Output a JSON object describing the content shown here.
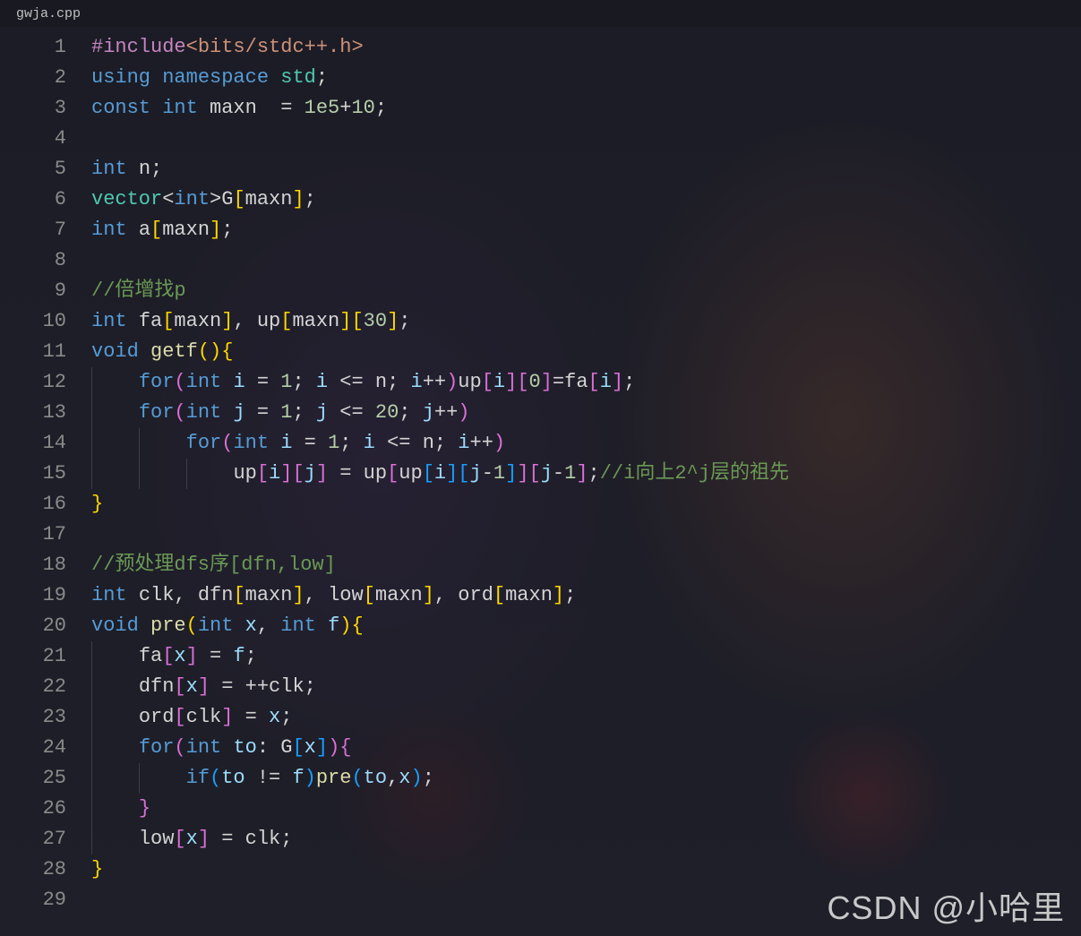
{
  "tab": {
    "filename": "gwja.cpp"
  },
  "watermark": "CSDN @小哈里",
  "gutter": {
    "start": 1,
    "end": 29
  },
  "code": {
    "lines": [
      {
        "n": 1,
        "tokens": [
          {
            "t": "#include",
            "c": "c-preproc"
          },
          {
            "t": "<bits/stdc++.h>",
            "c": "c-include"
          }
        ]
      },
      {
        "n": 2,
        "tokens": [
          {
            "t": "using",
            "c": "c-keyword"
          },
          {
            "t": " "
          },
          {
            "t": "namespace",
            "c": "c-keyword"
          },
          {
            "t": " "
          },
          {
            "t": "std",
            "c": "c-namespace"
          },
          {
            "t": ";",
            "c": "c-punct"
          }
        ]
      },
      {
        "n": 3,
        "tokens": [
          {
            "t": "const",
            "c": "c-const"
          },
          {
            "t": " "
          },
          {
            "t": "int",
            "c": "c-type"
          },
          {
            "t": " "
          },
          {
            "t": "maxn",
            "c": "c-id"
          },
          {
            "t": "  = "
          },
          {
            "t": "1e5",
            "c": "c-num"
          },
          {
            "t": "+",
            "c": "c-op"
          },
          {
            "t": "10",
            "c": "c-num"
          },
          {
            "t": ";",
            "c": "c-punct"
          }
        ]
      },
      {
        "n": 4,
        "tokens": []
      },
      {
        "n": 5,
        "tokens": [
          {
            "t": "int",
            "c": "c-type"
          },
          {
            "t": " "
          },
          {
            "t": "n",
            "c": "c-id"
          },
          {
            "t": ";",
            "c": "c-punct"
          }
        ]
      },
      {
        "n": 6,
        "tokens": [
          {
            "t": "vector",
            "c": "c-namespace"
          },
          {
            "t": "<",
            "c": "c-punct"
          },
          {
            "t": "int",
            "c": "c-type"
          },
          {
            "t": ">",
            "c": "c-punct"
          },
          {
            "t": "G",
            "c": "c-id"
          },
          {
            "t": "[",
            "c": "c-bracket-y"
          },
          {
            "t": "maxn",
            "c": "c-id"
          },
          {
            "t": "]",
            "c": "c-bracket-y"
          },
          {
            "t": ";",
            "c": "c-punct"
          }
        ]
      },
      {
        "n": 7,
        "tokens": [
          {
            "t": "int",
            "c": "c-type"
          },
          {
            "t": " "
          },
          {
            "t": "a",
            "c": "c-id"
          },
          {
            "t": "[",
            "c": "c-bracket-y"
          },
          {
            "t": "maxn",
            "c": "c-id"
          },
          {
            "t": "]",
            "c": "c-bracket-y"
          },
          {
            "t": ";",
            "c": "c-punct"
          }
        ]
      },
      {
        "n": 8,
        "tokens": []
      },
      {
        "n": 9,
        "tokens": [
          {
            "t": "//倍增找p",
            "c": "c-comment"
          }
        ]
      },
      {
        "n": 10,
        "tokens": [
          {
            "t": "int",
            "c": "c-type"
          },
          {
            "t": " "
          },
          {
            "t": "fa",
            "c": "c-id"
          },
          {
            "t": "[",
            "c": "c-bracket-y"
          },
          {
            "t": "maxn",
            "c": "c-id"
          },
          {
            "t": "]",
            "c": "c-bracket-y"
          },
          {
            "t": ", "
          },
          {
            "t": "up",
            "c": "c-id"
          },
          {
            "t": "[",
            "c": "c-bracket-y"
          },
          {
            "t": "maxn",
            "c": "c-id"
          },
          {
            "t": "]",
            "c": "c-bracket-y"
          },
          {
            "t": "[",
            "c": "c-bracket-y"
          },
          {
            "t": "30",
            "c": "c-num"
          },
          {
            "t": "]",
            "c": "c-bracket-y"
          },
          {
            "t": ";",
            "c": "c-punct"
          }
        ]
      },
      {
        "n": 11,
        "tokens": [
          {
            "t": "void",
            "c": "c-type"
          },
          {
            "t": " "
          },
          {
            "t": "getf",
            "c": "c-func"
          },
          {
            "t": "(",
            "c": "c-bracket-y"
          },
          {
            "t": ")",
            "c": "c-bracket-y"
          },
          {
            "t": "{",
            "c": "c-bracket-y"
          }
        ]
      },
      {
        "n": 12,
        "indent": 1,
        "tokens": [
          {
            "t": "for",
            "c": "c-keyword"
          },
          {
            "t": "(",
            "c": "c-bracket-p"
          },
          {
            "t": "int",
            "c": "c-type"
          },
          {
            "t": " "
          },
          {
            "t": "i",
            "c": "c-var"
          },
          {
            "t": " = "
          },
          {
            "t": "1",
            "c": "c-num"
          },
          {
            "t": "; "
          },
          {
            "t": "i",
            "c": "c-var"
          },
          {
            "t": " <= "
          },
          {
            "t": "n",
            "c": "c-id"
          },
          {
            "t": "; "
          },
          {
            "t": "i",
            "c": "c-var"
          },
          {
            "t": "++",
            "c": "c-op"
          },
          {
            "t": ")",
            "c": "c-bracket-p"
          },
          {
            "t": "up",
            "c": "c-id"
          },
          {
            "t": "[",
            "c": "c-bracket-p"
          },
          {
            "t": "i",
            "c": "c-var"
          },
          {
            "t": "]",
            "c": "c-bracket-p"
          },
          {
            "t": "[",
            "c": "c-bracket-p"
          },
          {
            "t": "0",
            "c": "c-num"
          },
          {
            "t": "]",
            "c": "c-bracket-p"
          },
          {
            "t": "=",
            "c": "c-op"
          },
          {
            "t": "fa",
            "c": "c-id"
          },
          {
            "t": "[",
            "c": "c-bracket-p"
          },
          {
            "t": "i",
            "c": "c-var"
          },
          {
            "t": "]",
            "c": "c-bracket-p"
          },
          {
            "t": ";",
            "c": "c-punct"
          }
        ]
      },
      {
        "n": 13,
        "indent": 1,
        "tokens": [
          {
            "t": "for",
            "c": "c-keyword"
          },
          {
            "t": "(",
            "c": "c-bracket-p"
          },
          {
            "t": "int",
            "c": "c-type"
          },
          {
            "t": " "
          },
          {
            "t": "j",
            "c": "c-var"
          },
          {
            "t": " = "
          },
          {
            "t": "1",
            "c": "c-num"
          },
          {
            "t": "; "
          },
          {
            "t": "j",
            "c": "c-var"
          },
          {
            "t": " <= "
          },
          {
            "t": "20",
            "c": "c-num"
          },
          {
            "t": "; "
          },
          {
            "t": "j",
            "c": "c-var"
          },
          {
            "t": "++",
            "c": "c-op"
          },
          {
            "t": ")",
            "c": "c-bracket-p"
          }
        ]
      },
      {
        "n": 14,
        "indent": 2,
        "tokens": [
          {
            "t": "for",
            "c": "c-keyword"
          },
          {
            "t": "(",
            "c": "c-bracket-p"
          },
          {
            "t": "int",
            "c": "c-type"
          },
          {
            "t": " "
          },
          {
            "t": "i",
            "c": "c-var"
          },
          {
            "t": " = "
          },
          {
            "t": "1",
            "c": "c-num"
          },
          {
            "t": "; "
          },
          {
            "t": "i",
            "c": "c-var"
          },
          {
            "t": " <= "
          },
          {
            "t": "n",
            "c": "c-id"
          },
          {
            "t": "; "
          },
          {
            "t": "i",
            "c": "c-var"
          },
          {
            "t": "++",
            "c": "c-op"
          },
          {
            "t": ")",
            "c": "c-bracket-p"
          }
        ]
      },
      {
        "n": 15,
        "indent": 3,
        "tokens": [
          {
            "t": "up",
            "c": "c-id"
          },
          {
            "t": "[",
            "c": "c-bracket-p"
          },
          {
            "t": "i",
            "c": "c-var"
          },
          {
            "t": "]",
            "c": "c-bracket-p"
          },
          {
            "t": "[",
            "c": "c-bracket-p"
          },
          {
            "t": "j",
            "c": "c-var"
          },
          {
            "t": "]",
            "c": "c-bracket-p"
          },
          {
            "t": " = "
          },
          {
            "t": "up",
            "c": "c-id"
          },
          {
            "t": "[",
            "c": "c-bracket-p"
          },
          {
            "t": "up",
            "c": "c-id"
          },
          {
            "t": "[",
            "c": "c-bracket-b"
          },
          {
            "t": "i",
            "c": "c-var"
          },
          {
            "t": "]",
            "c": "c-bracket-b"
          },
          {
            "t": "[",
            "c": "c-bracket-b"
          },
          {
            "t": "j",
            "c": "c-var"
          },
          {
            "t": "-",
            "c": "c-op"
          },
          {
            "t": "1",
            "c": "c-num"
          },
          {
            "t": "]",
            "c": "c-bracket-b"
          },
          {
            "t": "]",
            "c": "c-bracket-p"
          },
          {
            "t": "[",
            "c": "c-bracket-p"
          },
          {
            "t": "j",
            "c": "c-var"
          },
          {
            "t": "-",
            "c": "c-op"
          },
          {
            "t": "1",
            "c": "c-num"
          },
          {
            "t": "]",
            "c": "c-bracket-p"
          },
          {
            "t": ";",
            "c": "c-punct"
          },
          {
            "t": "//i向上2^j层的祖先",
            "c": "c-comment"
          }
        ]
      },
      {
        "n": 16,
        "tokens": [
          {
            "t": "}",
            "c": "c-bracket-y"
          }
        ]
      },
      {
        "n": 17,
        "tokens": []
      },
      {
        "n": 18,
        "tokens": [
          {
            "t": "//预处理dfs序[dfn,low]",
            "c": "c-comment"
          }
        ]
      },
      {
        "n": 19,
        "tokens": [
          {
            "t": "int",
            "c": "c-type"
          },
          {
            "t": " "
          },
          {
            "t": "clk",
            "c": "c-id"
          },
          {
            "t": ", "
          },
          {
            "t": "dfn",
            "c": "c-id"
          },
          {
            "t": "[",
            "c": "c-bracket-y"
          },
          {
            "t": "maxn",
            "c": "c-id"
          },
          {
            "t": "]",
            "c": "c-bracket-y"
          },
          {
            "t": ", "
          },
          {
            "t": "low",
            "c": "c-id"
          },
          {
            "t": "[",
            "c": "c-bracket-y"
          },
          {
            "t": "maxn",
            "c": "c-id"
          },
          {
            "t": "]",
            "c": "c-bracket-y"
          },
          {
            "t": ", "
          },
          {
            "t": "ord",
            "c": "c-id"
          },
          {
            "t": "[",
            "c": "c-bracket-y"
          },
          {
            "t": "maxn",
            "c": "c-id"
          },
          {
            "t": "]",
            "c": "c-bracket-y"
          },
          {
            "t": ";",
            "c": "c-punct"
          }
        ]
      },
      {
        "n": 20,
        "tokens": [
          {
            "t": "void",
            "c": "c-type"
          },
          {
            "t": " "
          },
          {
            "t": "pre",
            "c": "c-func"
          },
          {
            "t": "(",
            "c": "c-bracket-y"
          },
          {
            "t": "int",
            "c": "c-type"
          },
          {
            "t": " "
          },
          {
            "t": "x",
            "c": "c-var"
          },
          {
            "t": ", "
          },
          {
            "t": "int",
            "c": "c-type"
          },
          {
            "t": " "
          },
          {
            "t": "f",
            "c": "c-var"
          },
          {
            "t": ")",
            "c": "c-bracket-y"
          },
          {
            "t": "{",
            "c": "c-bracket-y"
          }
        ]
      },
      {
        "n": 21,
        "indent": 1,
        "tokens": [
          {
            "t": "fa",
            "c": "c-id"
          },
          {
            "t": "[",
            "c": "c-bracket-p"
          },
          {
            "t": "x",
            "c": "c-var"
          },
          {
            "t": "]",
            "c": "c-bracket-p"
          },
          {
            "t": " = "
          },
          {
            "t": "f",
            "c": "c-var"
          },
          {
            "t": ";",
            "c": "c-punct"
          }
        ]
      },
      {
        "n": 22,
        "indent": 1,
        "tokens": [
          {
            "t": "dfn",
            "c": "c-id"
          },
          {
            "t": "[",
            "c": "c-bracket-p"
          },
          {
            "t": "x",
            "c": "c-var"
          },
          {
            "t": "]",
            "c": "c-bracket-p"
          },
          {
            "t": " = ++",
            "c": "c-op"
          },
          {
            "t": "clk",
            "c": "c-id"
          },
          {
            "t": ";",
            "c": "c-punct"
          }
        ]
      },
      {
        "n": 23,
        "indent": 1,
        "tokens": [
          {
            "t": "ord",
            "c": "c-id"
          },
          {
            "t": "[",
            "c": "c-bracket-p"
          },
          {
            "t": "clk",
            "c": "c-id"
          },
          {
            "t": "]",
            "c": "c-bracket-p"
          },
          {
            "t": " = "
          },
          {
            "t": "x",
            "c": "c-var"
          },
          {
            "t": ";",
            "c": "c-punct"
          }
        ]
      },
      {
        "n": 24,
        "indent": 1,
        "tokens": [
          {
            "t": "for",
            "c": "c-keyword"
          },
          {
            "t": "(",
            "c": "c-bracket-p"
          },
          {
            "t": "int",
            "c": "c-type"
          },
          {
            "t": " "
          },
          {
            "t": "to",
            "c": "c-var"
          },
          {
            "t": ": "
          },
          {
            "t": "G",
            "c": "c-id"
          },
          {
            "t": "[",
            "c": "c-bracket-b"
          },
          {
            "t": "x",
            "c": "c-var"
          },
          {
            "t": "]",
            "c": "c-bracket-b"
          },
          {
            "t": ")",
            "c": "c-bracket-p"
          },
          {
            "t": "{",
            "c": "c-bracket-p"
          }
        ]
      },
      {
        "n": 25,
        "indent": 2,
        "tokens": [
          {
            "t": "if",
            "c": "c-keyword"
          },
          {
            "t": "(",
            "c": "c-bracket-b"
          },
          {
            "t": "to",
            "c": "c-var"
          },
          {
            "t": " != "
          },
          {
            "t": "f",
            "c": "c-var"
          },
          {
            "t": ")",
            "c": "c-bracket-b"
          },
          {
            "t": "pre",
            "c": "c-func"
          },
          {
            "t": "(",
            "c": "c-bracket-b"
          },
          {
            "t": "to",
            "c": "c-var"
          },
          {
            "t": ",",
            "c": "c-punct"
          },
          {
            "t": "x",
            "c": "c-var"
          },
          {
            "t": ")",
            "c": "c-bracket-b"
          },
          {
            "t": ";",
            "c": "c-punct"
          }
        ]
      },
      {
        "n": 26,
        "indent": 1,
        "tokens": [
          {
            "t": "}",
            "c": "c-bracket-p"
          }
        ]
      },
      {
        "n": 27,
        "indent": 1,
        "tokens": [
          {
            "t": "low",
            "c": "c-id"
          },
          {
            "t": "[",
            "c": "c-bracket-p"
          },
          {
            "t": "x",
            "c": "c-var"
          },
          {
            "t": "]",
            "c": "c-bracket-p"
          },
          {
            "t": " = "
          },
          {
            "t": "clk",
            "c": "c-id"
          },
          {
            "t": ";",
            "c": "c-punct"
          }
        ]
      },
      {
        "n": 28,
        "tokens": [
          {
            "t": "}",
            "c": "c-bracket-y"
          }
        ]
      },
      {
        "n": 29,
        "tokens": []
      }
    ]
  }
}
